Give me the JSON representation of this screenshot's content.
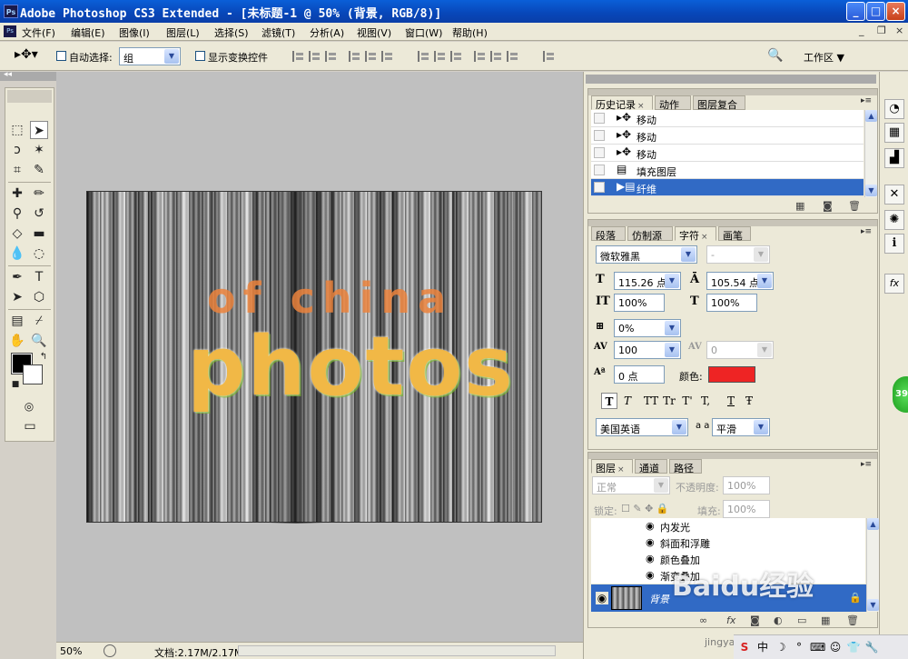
{
  "window": {
    "title": "Adobe Photoshop CS3 Extended - [未标题-1 @ 50% (背景, RGB/8)]",
    "app_icon": "Ps",
    "minimize": "_",
    "maximize": "□",
    "close": "×"
  },
  "menu": {
    "items": [
      "文件(F)",
      "编辑(E)",
      "图像(I)",
      "图层(L)",
      "选择(S)",
      "滤镜(T)",
      "分析(A)",
      "视图(V)",
      "窗口(W)",
      "帮助(H)"
    ],
    "doc_min": "_",
    "doc_restore": "❐",
    "doc_close": "×"
  },
  "options": {
    "auto_select_label": "自动选择:",
    "auto_select_value": "组",
    "show_transform_label": "显示变换控件",
    "workspace_label": "工作区"
  },
  "canvas": {
    "text_line1": "of china",
    "text_line2": "photos"
  },
  "status": {
    "zoom": "50%",
    "doc_info": "文档:2.17M/2.17M"
  },
  "history_panel": {
    "tabs": [
      "历史记录",
      "动作",
      "图层复合"
    ],
    "items": [
      {
        "icon": "move-icon",
        "label": "移动"
      },
      {
        "icon": "move-icon",
        "label": "移动"
      },
      {
        "icon": "move-icon",
        "label": "移动"
      },
      {
        "icon": "document-icon",
        "label": "填充图层"
      },
      {
        "icon": "document-icon",
        "label": "纤维"
      }
    ]
  },
  "character_panel": {
    "tabs": [
      "段落",
      "仿制源",
      "字符",
      "画笔"
    ],
    "font_family": "微软雅黑",
    "font_style": "-",
    "font_size": "115.26 点",
    "leading": "105.54 点",
    "vertical_scale": "100%",
    "horizontal_scale": "100%",
    "tracking_pct": "0%",
    "kerning": "100",
    "kerning_auto": "0",
    "baseline_shift": "0 点",
    "color_label": "颜色:",
    "color": "#ee2424",
    "format_buttons": [
      "T",
      "T",
      "TT",
      "Tr",
      "T'",
      "T,",
      "T",
      "Ŧ"
    ],
    "language": "美国英语",
    "aa_label": "a a",
    "antialias": "平滑"
  },
  "layers_panel": {
    "tabs": [
      "图层",
      "通道",
      "路径"
    ],
    "blend_mode": "正常",
    "opacity_label": "不透明度:",
    "opacity": "100%",
    "lock_label": "锁定:",
    "fill_label": "填充:",
    "fill": "100%",
    "effects": [
      "内发光",
      "斜面和浮雕",
      "颜色叠加",
      "渐变叠加"
    ],
    "layer_name": "背景"
  },
  "watermark": {
    "text": "Baidu经验",
    "url": "jingyan.baidu.com"
  },
  "badge": "39"
}
